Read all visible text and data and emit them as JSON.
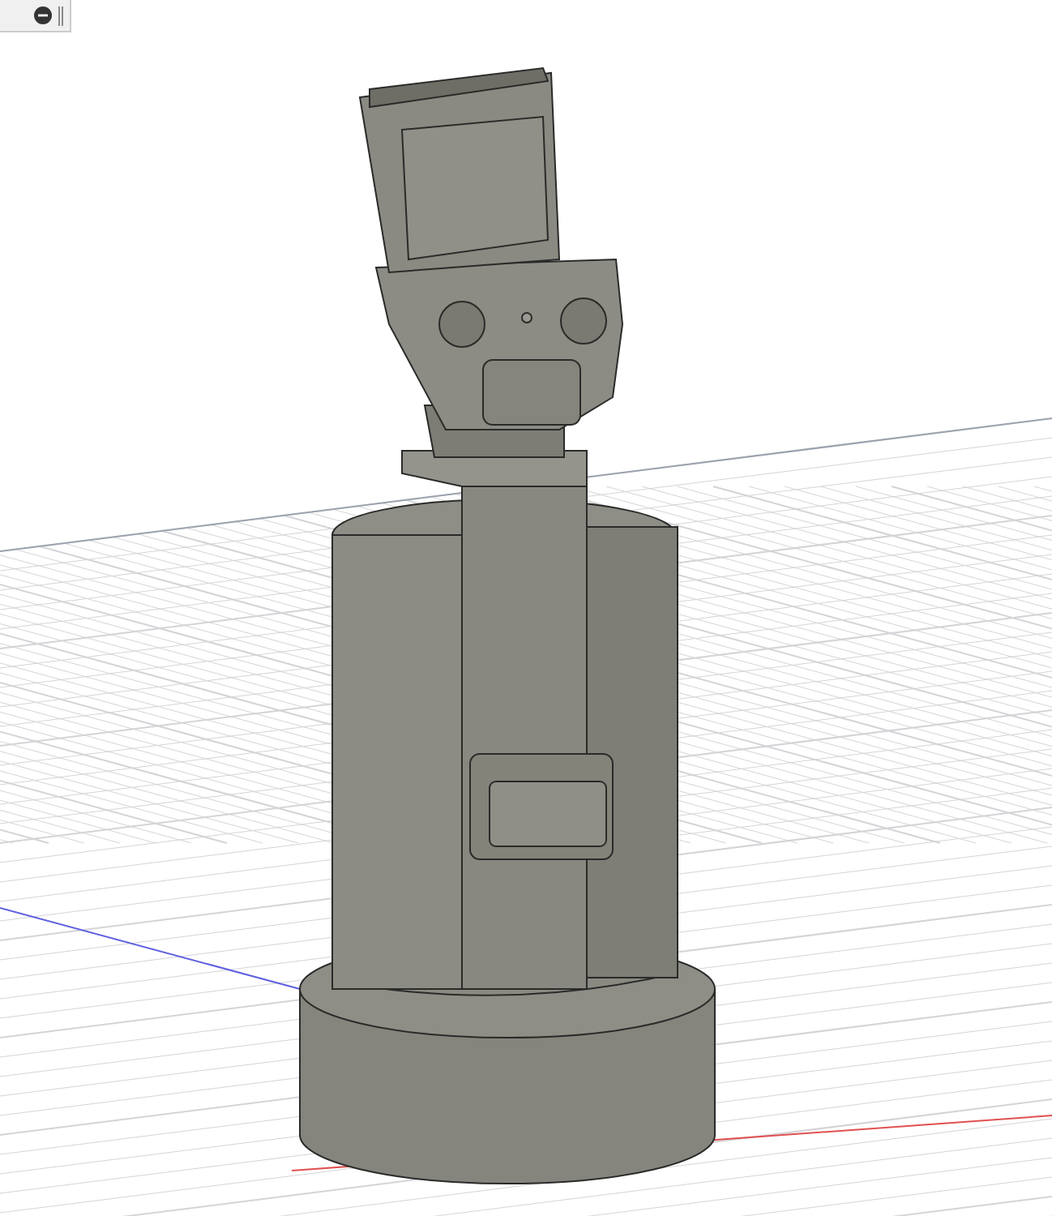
{
  "browser_panel": {
    "collapsed": false
  }
}
